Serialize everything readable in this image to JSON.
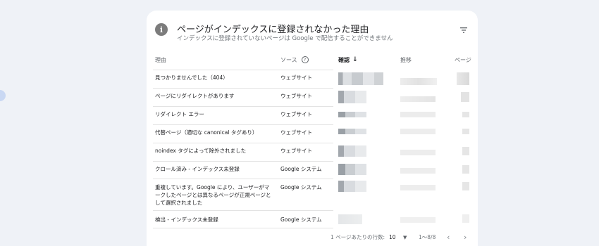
{
  "panel": {
    "title": "ページがインデックスに登録されなかった理由",
    "subtitle": "インデックスに登録されていないページは Google で配信することができません"
  },
  "columns": {
    "reason": "理由",
    "source": "ソース",
    "confirm": "確認",
    "trend": "推移",
    "pages": "ページ"
  },
  "rows": [
    {
      "reason": "見つかりませんでした（404）",
      "source": "ウェブサイト"
    },
    {
      "reason": "ページにリダイレクトがあります",
      "source": "ウェブサイト"
    },
    {
      "reason": "リダイレクト エラー",
      "source": "ウェブサイト"
    },
    {
      "reason": "代替ページ（適切な canonical タグあり）",
      "source": "ウェブサイト"
    },
    {
      "reason": "noindex タグによって除外されました",
      "source": "ウェブサイト"
    },
    {
      "reason": "クロール済み - インデックス未登録",
      "source": "Google システム"
    },
    {
      "reason": "重複しています。Google により、ユーザーがマークしたページとは異なるページが正規ページとして選択されました",
      "source": "Google システム"
    },
    {
      "reason": "検出 - インデックス未登録",
      "source": "Google システム"
    }
  ],
  "footer": {
    "rows_per_page_label": "1 ページあたりの行数:",
    "rows_per_page_value": "10",
    "range": "1〜8/8"
  },
  "icons": [
    "info-icon",
    "filter-icon",
    "help-icon",
    "sort-arrow-down-icon",
    "chevron-left-icon",
    "chevron-right-icon",
    "dropdown-caret-icon"
  ]
}
